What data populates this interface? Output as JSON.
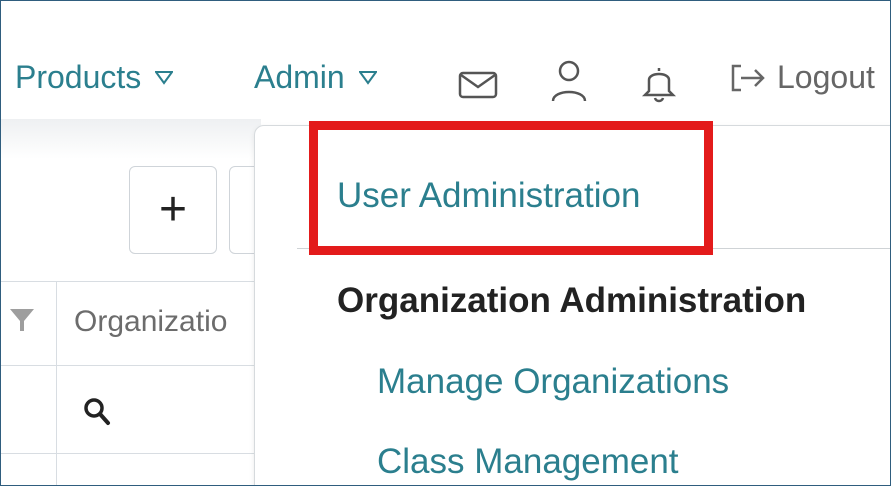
{
  "nav": {
    "products_label": "Products",
    "admin_label": "Admin",
    "logout_label": "Logout",
    "icons": [
      "mail-icon",
      "user-icon",
      "bell-icon",
      "logout-icon"
    ]
  },
  "toolbar": {
    "add_symbol": "+"
  },
  "table": {
    "column_header": "Organizatio"
  },
  "admin_menu": {
    "user_administration": "User Administration",
    "section_heading": "Organization Administration",
    "manage_organizations": "Manage Organizations",
    "class_management": "Class Management"
  },
  "colors": {
    "link": "#2b7f8e",
    "highlight": "#e31b1b"
  }
}
